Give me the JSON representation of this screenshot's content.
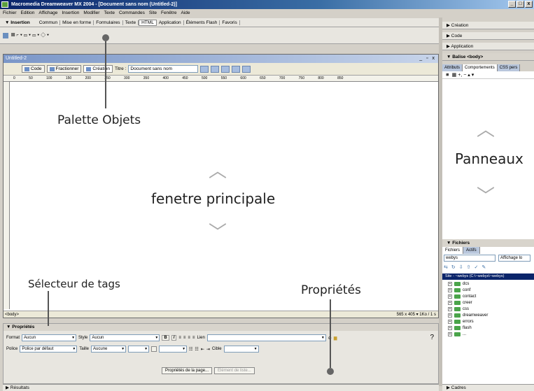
{
  "title_bar": {
    "text": "Macromedia Dreamweaver MX 2004 - [Document sans nom (Untitled-2)]",
    "buttons": [
      "_",
      "□",
      "x"
    ]
  },
  "menu": [
    "Fichier",
    "Edition",
    "Affichage",
    "Insertion",
    "Modifier",
    "Texte",
    "Commandes",
    "Site",
    "Fenêtre",
    "Aide"
  ],
  "insert_bar": {
    "title": "▼ Insertion",
    "tabs": [
      "Commun",
      "Mise en forme",
      "Formulaires",
      "Texte",
      "HTML",
      "Application",
      "Éléments Flash",
      "Favoris"
    ],
    "active": "HTML",
    "objects": "▤ ፦ ▾ ▭ ▾ ▭ ▾ ◇ ▾"
  },
  "document": {
    "tab": "Untitled-2",
    "controls": "_ ▫ x",
    "view_buttons": [
      "Code",
      "Fractionner",
      "Création"
    ],
    "title_label": "Titre :",
    "title_value": "Document sans nom",
    "ruler": "0 50 100 150 200 250 300 350 400 450 500 550 600 650 700 750 800 850",
    "tag_selector": "<body>",
    "status": "565 x 405 ▾ 1Ko / 1 s"
  },
  "right_panel": {
    "headers": [
      "▶ Création",
      "▶ Code",
      "▶ Application",
      "▼ Balise <body>"
    ],
    "tabs": [
      "Attributs",
      "Comportements",
      "CSS pers"
    ],
    "tools": "◾ ▦  +, −  ▴ ▾",
    "files_header": "▼ Fichiers",
    "files_tabs": [
      "Fichiers",
      "Actifs"
    ],
    "site": "webys",
    "view": "Affichage lo",
    "site_root": "Site - ~webys (C:\\~webys\\~webys)",
    "folders": [
      "dcs",
      "conf",
      "contact",
      "creer",
      "css",
      "dreamweaver",
      "errors",
      "flash",
      "..."
    ],
    "bottom": "▶ Cadres"
  },
  "properties": {
    "header": "▼ Propriétés",
    "format_label": "Format",
    "format_value": "Aucun",
    "style_label": "Style",
    "style_value": "Aucun",
    "font_label": "Police",
    "font_value": "Police par défaut",
    "size_label": "Taille",
    "size_value": "Aucune",
    "link_label": "Lien",
    "target_label": "Cible",
    "page_props": "Propriétés de la page...",
    "list_item": "Élément de liste..."
  },
  "results": "▶ Résultats",
  "annotations": {
    "objects": "Palette Objets",
    "main": "fenetre principale",
    "panels": "Panneaux",
    "tags": "Sélecteur de tags",
    "props": "Propriétés"
  }
}
